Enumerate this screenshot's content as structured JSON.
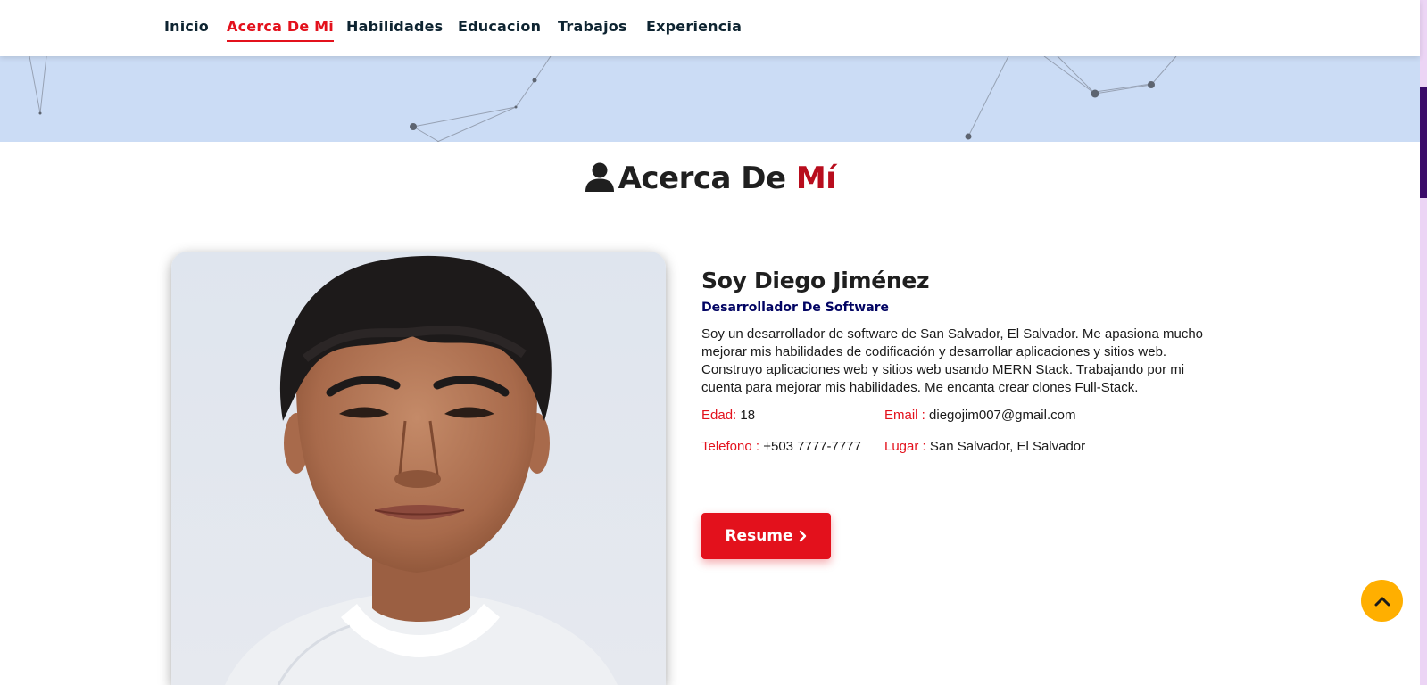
{
  "nav": {
    "items": [
      {
        "label": "Inicio"
      },
      {
        "label": "Acerca De Mi"
      },
      {
        "label": "Habilidades"
      },
      {
        "label": "Educacion"
      },
      {
        "label": "Trabajos"
      },
      {
        "label": "Experiencia"
      }
    ],
    "active_index": 1
  },
  "section": {
    "icon": "user-icon",
    "title_main": "Acerca De",
    "title_accent": "Mí"
  },
  "profile": {
    "photo_icon": "profile-photo",
    "name": "Soy Diego Jiménez",
    "role": "Desarrollador De Software",
    "bio": "Soy un desarrollador de software de San Salvador, El Salvador. Me apasiona mucho mejorar mis habilidades de codificación y desarrollar aplicaciones y sitios web. Construyo aplicaciones web y sitios web usando MERN Stack. Trabajando por mi cuenta para mejorar mis habilidades. Me encanta crear clones Full-Stack.",
    "info": {
      "age_label": "Edad:",
      "age_value": "18",
      "email_label": "Email :",
      "email_value": "diegojim007@gmail.com",
      "phone_label": "Telefono :",
      "phone_value": "+503 7777-7777",
      "place_label": "Lugar :",
      "place_value": "San Salvador, El Salvador"
    },
    "resume_label": "Resume"
  },
  "scroll_top": {
    "icon": "chevron-up-icon"
  },
  "colors": {
    "accent": "#e3111c",
    "heading_accent": "#b80d1d",
    "role": "#020463",
    "banner": "#cbdcf5",
    "scroll_top": "#ffaf00",
    "nav_text": "#0e2431"
  }
}
